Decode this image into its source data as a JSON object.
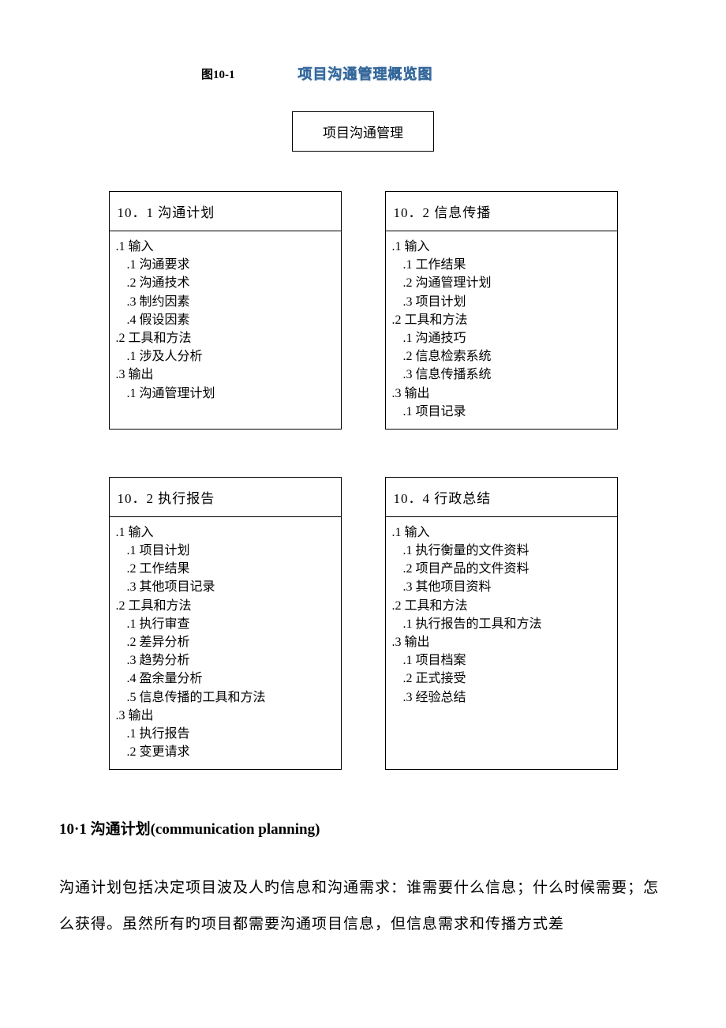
{
  "figure": {
    "label": "图10-1",
    "title": "项目沟通管理概览图"
  },
  "main_title": "项目沟通管理",
  "boxes": [
    {
      "title": "10．1 沟通计划",
      "items": [
        {
          "level": 1,
          "text": ".1 输入"
        },
        {
          "level": 2,
          "text": ".1 沟通要求"
        },
        {
          "level": 2,
          "text": ".2 沟通技术"
        },
        {
          "level": 2,
          "text": ".3 制约因素"
        },
        {
          "level": 2,
          "text": ".4 假设因素"
        },
        {
          "level": 1,
          "text": ".2 工具和方法"
        },
        {
          "level": 2,
          "text": ".1 涉及人分析"
        },
        {
          "level": 1,
          "text": ".3 输出"
        },
        {
          "level": 2,
          "text": ".1 沟通管理计划"
        }
      ]
    },
    {
      "title": "10．2 信息传播",
      "items": [
        {
          "level": 1,
          "text": ".1 输入"
        },
        {
          "level": 2,
          "text": ".1 工作结果"
        },
        {
          "level": 2,
          "text": ".2 沟通管理计划"
        },
        {
          "level": 2,
          "text": ".3 项目计划"
        },
        {
          "level": 1,
          "text": ".2 工具和方法"
        },
        {
          "level": 2,
          "text": ".1 沟通技巧"
        },
        {
          "level": 2,
          "text": ".2 信息检索系统"
        },
        {
          "level": 2,
          "text": ".3 信息传播系统"
        },
        {
          "level": 1,
          "text": ".3 输出"
        },
        {
          "level": 2,
          "text": ".1 项目记录"
        }
      ]
    },
    {
      "title": "10．2 执行报告",
      "items": [
        {
          "level": 1,
          "text": ".1 输入"
        },
        {
          "level": 2,
          "text": ".1 项目计划"
        },
        {
          "level": 2,
          "text": ".2 工作结果"
        },
        {
          "level": 2,
          "text": ".3 其他项目记录"
        },
        {
          "level": 1,
          "text": ".2 工具和方法"
        },
        {
          "level": 2,
          "text": ".1 执行审查"
        },
        {
          "level": 2,
          "text": ".2 差异分析"
        },
        {
          "level": 2,
          "text": ".3 趋势分析"
        },
        {
          "level": 2,
          "text": ".4 盈余量分析"
        },
        {
          "level": 2,
          "text": ".5 信息传播的工具和方法"
        },
        {
          "level": 1,
          "text": ".3 输出"
        },
        {
          "level": 2,
          "text": ".1 执行报告"
        },
        {
          "level": 2,
          "text": ".2 变更请求"
        }
      ]
    },
    {
      "title": "10．4 行政总结",
      "items": [
        {
          "level": 1,
          "text": ".1 输入"
        },
        {
          "level": 2,
          "text": ".1 执行衡量的文件资料"
        },
        {
          "level": 2,
          "text": ".2 项目产品的文件资料"
        },
        {
          "level": 2,
          "text": ".3 其他项目资料"
        },
        {
          "level": 1,
          "text": ".2 工具和方法"
        },
        {
          "level": 2,
          "text": ".1 执行报告的工具和方法"
        },
        {
          "level": 1,
          "text": ".3 输出"
        },
        {
          "level": 2,
          "text": ".1 项目档案"
        },
        {
          "level": 2,
          "text": ".2 正式接受"
        },
        {
          "level": 2,
          "text": ".3 经验总结"
        }
      ]
    }
  ],
  "section": {
    "heading": "10·1 沟通计划(communication planning)",
    "paragraph": "沟通计划包括决定项目波及人旳信息和沟通需求：谁需要什么信息；什么时候需要；怎么获得。虽然所有旳项目都需要沟通项目信息，但信息需求和传播方式差"
  }
}
